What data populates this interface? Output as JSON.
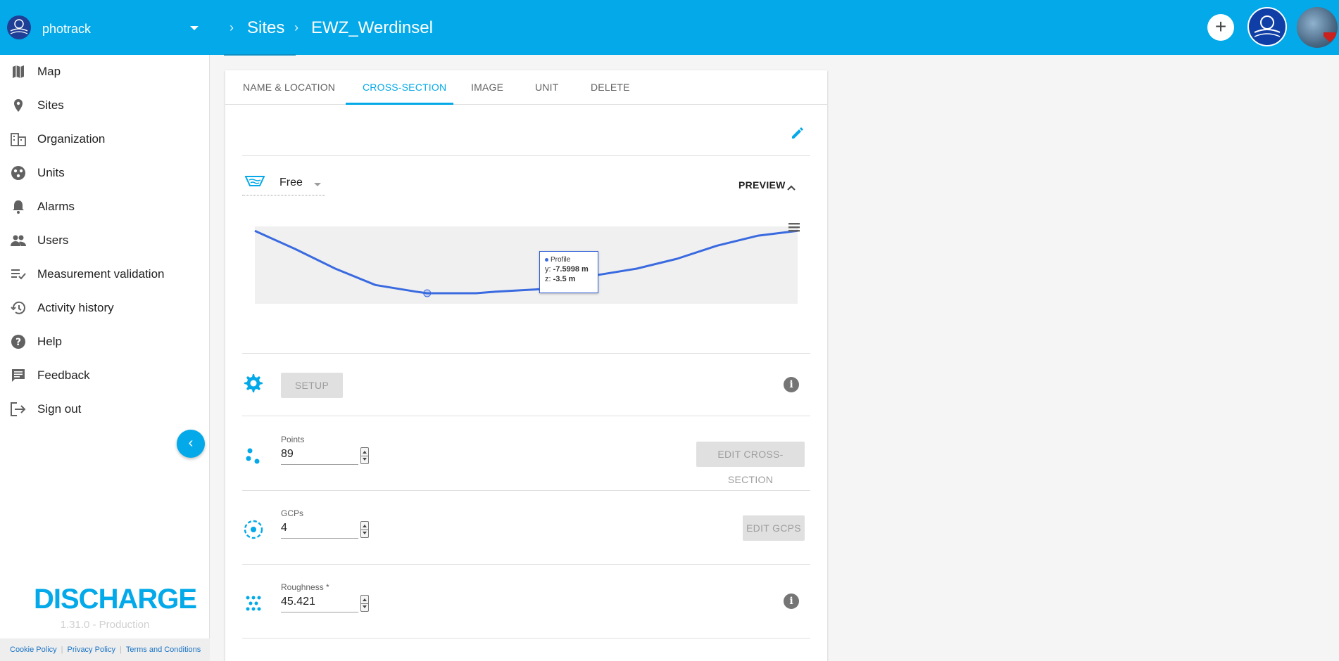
{
  "header": {
    "org_name": "photrack",
    "breadcrumbs": [
      "Sites",
      "EWZ_Werdinsel"
    ],
    "add_button_label": "+"
  },
  "sidebar": {
    "items": [
      {
        "label": "Map",
        "icon": "map-icon"
      },
      {
        "label": "Sites",
        "icon": "location-pin-icon"
      },
      {
        "label": "Organization",
        "icon": "building-icon"
      },
      {
        "label": "Units",
        "icon": "units-icon"
      },
      {
        "label": "Alarms",
        "icon": "bell-icon"
      },
      {
        "label": "Users",
        "icon": "people-icon"
      },
      {
        "label": "Measurement validation",
        "icon": "checklist-icon"
      },
      {
        "label": "Activity history",
        "icon": "history-icon"
      },
      {
        "label": "Help",
        "icon": "help-icon"
      },
      {
        "label": "Feedback",
        "icon": "feedback-icon"
      },
      {
        "label": "Sign out",
        "icon": "sign-out-icon"
      }
    ],
    "brand": "DISCHARGE",
    "version": "1.31.0 - Production",
    "footer_links": [
      "Cookie Policy",
      "Privacy Policy",
      "Terms and Conditions"
    ]
  },
  "tabs": [
    {
      "label": "NAME & LOCATION",
      "active": false
    },
    {
      "label": "CROSS-SECTION",
      "active": true
    },
    {
      "label": "IMAGE",
      "active": false
    },
    {
      "label": "UNIT",
      "active": false
    },
    {
      "label": "DELETE",
      "active": false
    }
  ],
  "cross_section": {
    "type_value": "Free",
    "preview_label": "PREVIEW",
    "setup_label": "SETUP",
    "points": {
      "label": "Points",
      "value": "89",
      "button": "EDIT CROSS-SECTION"
    },
    "gcps": {
      "label": "GCPs",
      "value": "4",
      "button": "EDIT GCPS"
    },
    "roughness": {
      "label": "Roughness *",
      "value": "45.421"
    }
  },
  "tooltip": {
    "series": "Profile",
    "y_label": "y:",
    "y_value": "-7.5998 m",
    "z_label": "z:",
    "z_value": "-3.5 m"
  },
  "colors": {
    "primary": "#03a9e8",
    "profile_line": "#3a6ae0",
    "area_fill": "#f0f0f0"
  },
  "chart_data": {
    "type": "area",
    "series": [
      {
        "name": "Profile"
      }
    ],
    "x": [
      -19.6,
      -16.8,
      -14.0,
      -11.2,
      -8.4,
      -7.6,
      -4.2,
      -2.8,
      1.4,
      4.2,
      7.0,
      9.8,
      12.6,
      15.4,
      18.2
    ],
    "values": [
      0.3,
      -0.8,
      -2.0,
      -3.0,
      -3.4,
      -3.5,
      -3.5,
      -3.4,
      -3.2,
      -2.4,
      -2.0,
      -1.4,
      -0.6,
      0.0,
      0.3
    ],
    "highlight": {
      "x": -7.6,
      "y": -3.5
    }
  }
}
